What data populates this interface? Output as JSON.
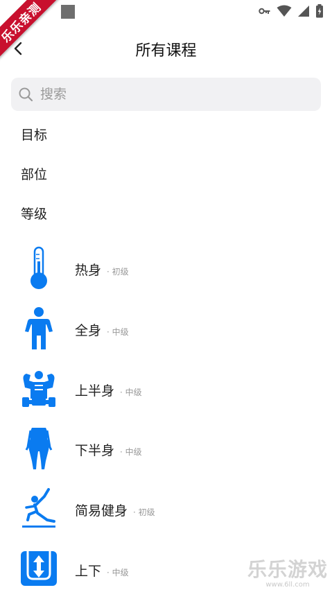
{
  "banner": "乐乐亲测",
  "header": {
    "title": "所有课程",
    "back_icon": "chevron-left-icon"
  },
  "search": {
    "placeholder": "搜索",
    "value": ""
  },
  "filters": [
    {
      "label": "目标"
    },
    {
      "label": "部位"
    },
    {
      "label": "等级"
    }
  ],
  "courses": [
    {
      "name": "热身",
      "level": "· 初级",
      "icon": "thermometer-icon"
    },
    {
      "name": "全身",
      "level": "· 中级",
      "icon": "person-icon"
    },
    {
      "name": "上半身",
      "level": "· 中级",
      "icon": "muscle-upper-body-icon"
    },
    {
      "name": "下半身",
      "level": "· 中级",
      "icon": "lower-body-icon"
    },
    {
      "name": "简易健身",
      "level": "· 初级",
      "icon": "stretch-icon"
    },
    {
      "name": "上下",
      "level": "· 中级",
      "icon": "up-down-arrow-icon"
    }
  ],
  "watermark": {
    "title": "乐乐游戏",
    "url": "www.6ll.com"
  },
  "colors": {
    "accent": "#0a7bf0",
    "banner": "#c8102e",
    "search_bg": "#f1f1f3"
  }
}
